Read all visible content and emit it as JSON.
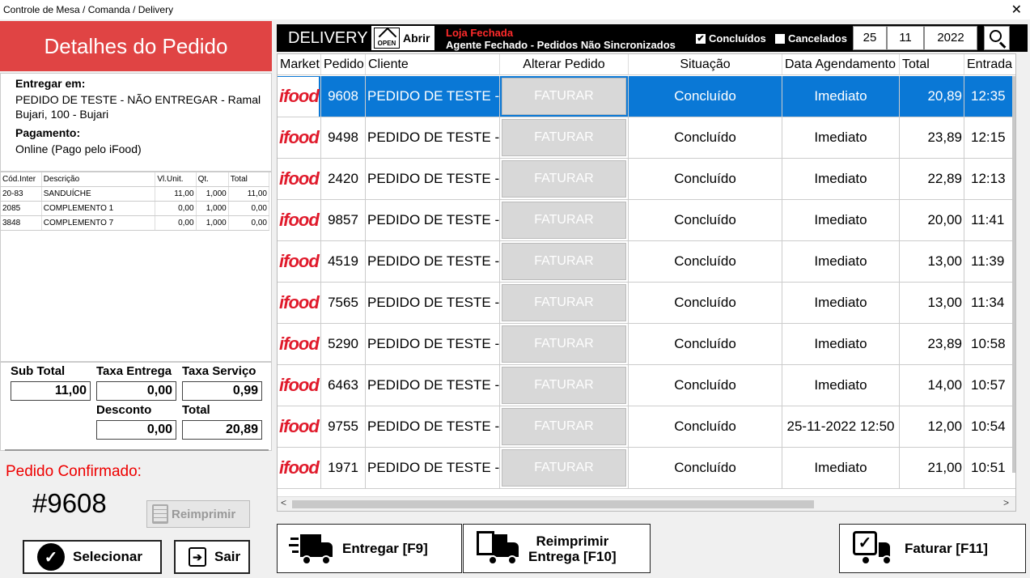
{
  "window": {
    "title": "Controle de Mesa / Comanda / Delivery",
    "close": "✕"
  },
  "details": {
    "header": "Detalhes do Pedido",
    "deliver_label": "Entregar em:",
    "deliver_value": "PEDIDO DE TESTE - NÃO ENTREGAR - Ramal Bujari, 100 - Bujari",
    "payment_label": "Pagamento:",
    "payment_value": "Online (Pago pelo iFood)",
    "items_columns": [
      "Cód.Inter",
      "Descrição",
      "Vl.Unit.",
      "Qt.",
      "Total"
    ],
    "items": [
      [
        "20-83",
        "SANDUÍCHE",
        "11,00",
        "1,000",
        "11,00"
      ],
      [
        "2085",
        "COMPLEMENTO 1",
        "0,00",
        "1,000",
        "0,00"
      ],
      [
        "3848",
        "COMPLEMENTO 7",
        "0,00",
        "1,000",
        "0,00"
      ]
    ],
    "subtotal_label": "Sub Total",
    "subtotal": "11,00",
    "taxa_entrega_label": "Taxa Entrega",
    "taxa_entrega": "0,00",
    "taxa_servico_label": "Taxa Serviço",
    "taxa_servico": "0,99",
    "desconto_label": "Desconto",
    "desconto": "0,00",
    "total_label": "Total",
    "total": "20,89",
    "confirmed_label": "Pedido Confirmado:",
    "order_number": "#9608",
    "reprint_label": "Reimprimir",
    "select_label": "Selecionar",
    "exit_label": "Sair"
  },
  "toolbar": {
    "title": "DELIVERY",
    "open_icon_text": "OPEN",
    "open_label": "Abrir",
    "status_store": "Loja Fechada",
    "status_agent": "Agente Fechado - Pedidos Não Sincronizados",
    "concluidos_label": "Concluídos",
    "concluidos_checked": "✔",
    "cancelados_label": "Cancelados",
    "day": "25",
    "month": "11",
    "year": "2022"
  },
  "grid": {
    "columns": [
      "Market",
      "Pedido",
      "Cliente",
      "Alterar Pedido",
      "Situação",
      "Data Agendamento",
      "Total",
      "Entrada"
    ],
    "market_logo_text": "ifood",
    "faturar_label": "FATURAR",
    "rows": [
      {
        "pedido": "9608",
        "cliente": "PEDIDO DE TESTE - Jo",
        "situacao": "Concluído",
        "data": "Imediato",
        "total": "20,89",
        "entrada": "12:35"
      },
      {
        "pedido": "9498",
        "cliente": "PEDIDO DE TESTE - Jo",
        "situacao": "Concluído",
        "data": "Imediato",
        "total": "23,89",
        "entrada": "12:15"
      },
      {
        "pedido": "2420",
        "cliente": "PEDIDO DE TESTE - Jo",
        "situacao": "Concluído",
        "data": "Imediato",
        "total": "22,89",
        "entrada": "12:13"
      },
      {
        "pedido": "9857",
        "cliente": "PEDIDO DE TESTE - Jo",
        "situacao": "Concluído",
        "data": "Imediato",
        "total": "20,00",
        "entrada": "11:41"
      },
      {
        "pedido": "4519",
        "cliente": "PEDIDO DE TESTE - Jo",
        "situacao": "Concluído",
        "data": "Imediato",
        "total": "13,00",
        "entrada": "11:39"
      },
      {
        "pedido": "7565",
        "cliente": "PEDIDO DE TESTE - Jo",
        "situacao": "Concluído",
        "data": "Imediato",
        "total": "13,00",
        "entrada": "11:34"
      },
      {
        "pedido": "5290",
        "cliente": "PEDIDO DE TESTE - Jo",
        "situacao": "Concluído",
        "data": "Imediato",
        "total": "23,89",
        "entrada": "10:58"
      },
      {
        "pedido": "6463",
        "cliente": "PEDIDO DE TESTE - Jo",
        "situacao": "Concluído",
        "data": "Imediato",
        "total": "14,00",
        "entrada": "10:57"
      },
      {
        "pedido": "9755",
        "cliente": "PEDIDO DE TESTE - Jo",
        "situacao": "Concluído",
        "data": "25-11-2022 12:50",
        "total": "12,00",
        "entrada": "10:54"
      },
      {
        "pedido": "1971",
        "cliente": "PEDIDO DE TESTE - Jo",
        "situacao": "Concluído",
        "data": "Imediato",
        "total": "21,00",
        "entrada": "10:51"
      }
    ]
  },
  "buttons": {
    "entregar": "Entregar [F9]",
    "reimprimir_line1": "Reimprimir",
    "reimprimir_line2": "Entrega [F10]",
    "faturar": "Faturar [F11]"
  },
  "colors": {
    "header_red": "#e04444",
    "selected_row": "#0a78d6",
    "ifood_red": "#e01a2b"
  }
}
